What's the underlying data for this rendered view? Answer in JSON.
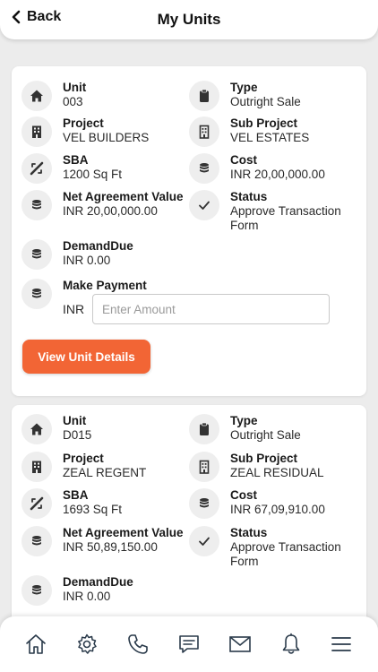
{
  "header": {
    "back_label": "Back",
    "title": "My Units"
  },
  "units": [
    {
      "unit_label": "Unit",
      "unit": "003",
      "type_label": "Type",
      "type": "Outright Sale",
      "project_label": "Project",
      "project": "VEL BUILDERS",
      "sub_project_label": "Sub Project",
      "sub_project": "VEL ESTATES",
      "sba_label": "SBA",
      "sba": "1200 Sq Ft",
      "cost_label": "Cost",
      "cost": "INR 20,00,000.00",
      "nav_label": "Net Agreement Value",
      "nav": "INR 20,00,000.00",
      "status_label": "Status",
      "status": "Approve Transaction Form",
      "demand_label": "DemandDue",
      "demand": "INR 0.00",
      "payment_label": "Make Payment",
      "currency": "INR",
      "amount_placeholder": "Enter Amount",
      "amount_value": "",
      "view_button": "View Unit Details"
    },
    {
      "unit_label": "Unit",
      "unit": "D015",
      "type_label": "Type",
      "type": "Outright Sale",
      "project_label": "Project",
      "project": "ZEAL REGENT",
      "sub_project_label": "Sub Project",
      "sub_project": "ZEAL RESIDUAL",
      "sba_label": "SBA",
      "sba": "1693 Sq Ft",
      "cost_label": "Cost",
      "cost": "INR 67,09,910.00",
      "nav_label": "Net Agreement Value",
      "nav": "INR 50,89,150.00",
      "status_label": "Status",
      "status": "Approve Transaction Form",
      "demand_label": "DemandDue",
      "demand": "INR 0.00"
    }
  ],
  "icons": {
    "home": "home-icon",
    "clipboard": "clipboard-icon",
    "building": "building-icon",
    "area": "area-icon",
    "coins": "coins-icon",
    "check": "check-icon"
  },
  "bottom_nav": [
    "home-icon",
    "settings-icon",
    "phone-icon",
    "chat-icon",
    "mail-icon",
    "bell-icon",
    "menu-icon"
  ],
  "colors": {
    "accent": "#f26535",
    "background": "#ececec",
    "card": "#ffffff"
  }
}
